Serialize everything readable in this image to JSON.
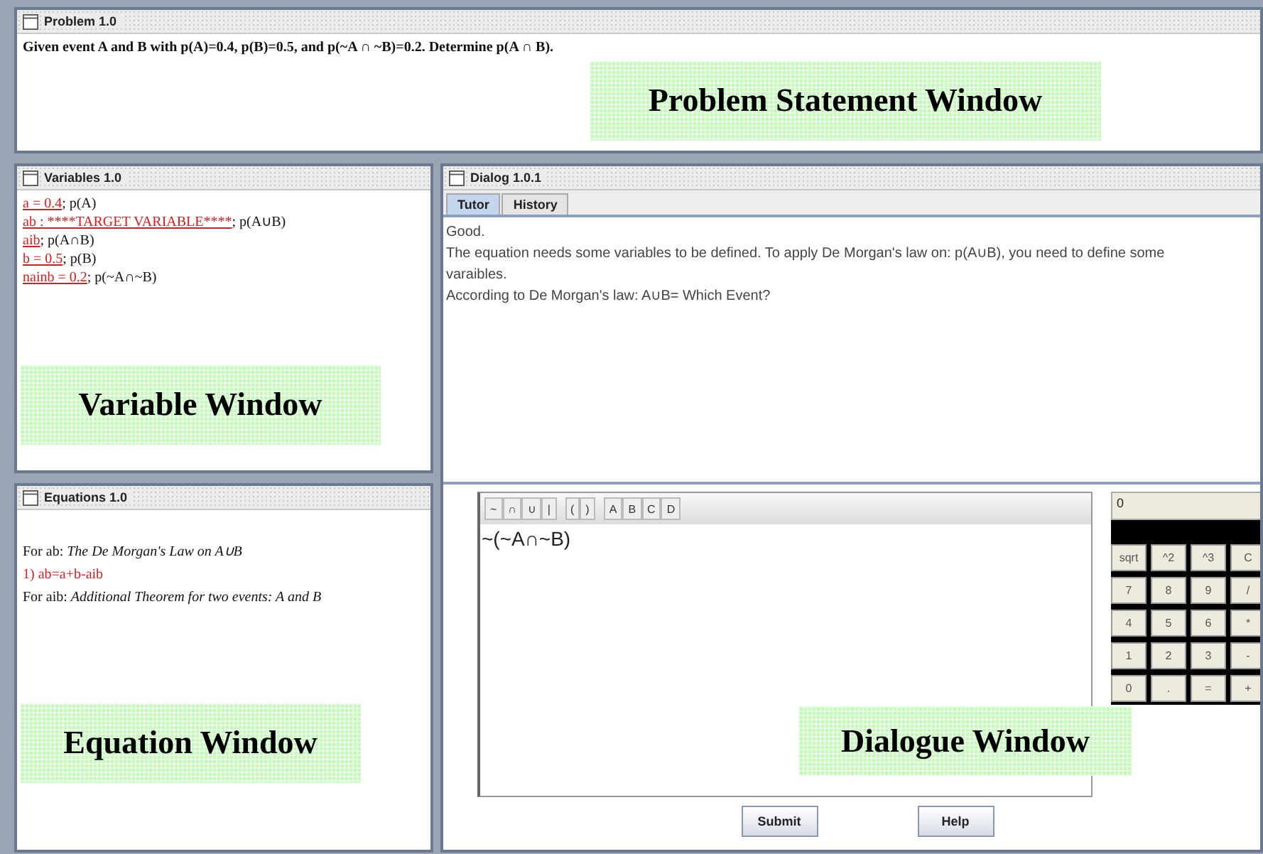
{
  "problem_window": {
    "title": "Problem 1.0",
    "statement": "Given event A and B with p(A)=0.4, p(B)=0.5, and p(~A ∩ ~B)=0.2. Determine p(A ∩ B)."
  },
  "variables_window": {
    "title": "Variables 1.0",
    "items": [
      {
        "link": "a = 0.4",
        "description": "; p(A)"
      },
      {
        "link": "ab : ****TARGET VARIABLE****",
        "description": "; p(A∪B)"
      },
      {
        "link": "aib",
        "description": "; p(A∩B)"
      },
      {
        "link": "b = 0.5",
        "description": "; p(B)"
      },
      {
        "link": "nainb = 0.2",
        "description": "; p(~A∩~B)"
      }
    ]
  },
  "equations_window": {
    "title": "Equations 1.0",
    "lines": [
      {
        "kind": "note",
        "text": "For ab: *The De Morgan's Law on A∪B*"
      },
      {
        "kind": "equation",
        "text": "1) ab=a+b-aib"
      },
      {
        "kind": "note",
        "text": "For aib: *Additional Theorem for two events: A and B*"
      }
    ]
  },
  "dialog_window": {
    "title": "Dialog 1.0.1",
    "tabs": [
      {
        "label": "Tutor",
        "selected": true
      },
      {
        "label": "History",
        "selected": false
      }
    ],
    "messages": [
      "Good.",
      "The equation needs some variables to be defined. To apply De Morgan's law on: p(A∪B), you need to define some varaibles.",
      "According to De Morgan's law: A∪B= Which Event?"
    ],
    "toolbar_groups": [
      [
        "~",
        "∩",
        "∪",
        "|"
      ],
      [
        "(",
        ")"
      ],
      [
        "A",
        "B",
        "C",
        "D"
      ]
    ],
    "editor_value": "~(~A∩~B)",
    "calculator": {
      "display": "0",
      "keys": [
        [
          "sqrt",
          "^2",
          "^3",
          "C"
        ],
        [
          "7",
          "8",
          "9",
          "/"
        ],
        [
          "4",
          "5",
          "6",
          "*"
        ],
        [
          "1",
          "2",
          "3",
          "-"
        ],
        [
          "0",
          ".",
          "=",
          "+"
        ]
      ]
    },
    "buttons": [
      "Submit",
      "Help"
    ]
  },
  "annotations": [
    {
      "kind": "problem",
      "text": "Problem Statement Window"
    },
    {
      "kind": "variable",
      "text": "Variable Window"
    },
    {
      "kind": "equation",
      "text": "Equation Window"
    },
    {
      "kind": "dialogue",
      "text": "Dialogue Window"
    }
  ]
}
